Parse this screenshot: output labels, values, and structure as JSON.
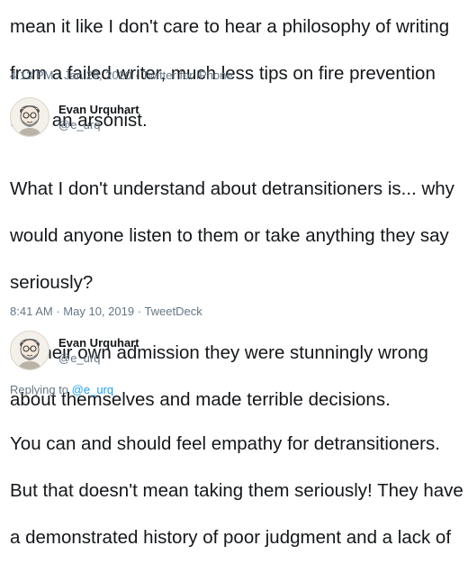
{
  "tweet1": {
    "lines": [
      "mean it like I don't care to hear a philosophy of writing",
      "from a failed writer, much less tips on fire prevention",
      "from an arsonist."
    ],
    "time": "4:13 PM",
    "date": "Jan 29, 2020",
    "client": "Twitter for iPhone"
  },
  "tweet2": {
    "author_name": "Evan Urquhart",
    "author_handle": "@e_urq",
    "para1": [
      "What I don't understand about detransitioners is... why",
      "would anyone listen to them or take anything they say",
      "seriously?"
    ],
    "para2": [
      "By their own admission they were stunningly wrong",
      "about themselves and made terrible decisions."
    ],
    "time": "8:41 AM",
    "date": "May 10, 2019",
    "client": "TweetDeck"
  },
  "tweet3": {
    "author_name": "Evan Urquhart",
    "author_handle": "@e_urq",
    "replying_label": "Replying to",
    "replying_to": "@e_urq",
    "lines": [
      "You can and should feel empathy for detransitioners.",
      "But that doesn't mean taking them seriously! They have",
      "a demonstrated history of poor judgment and a lack of"
    ]
  },
  "separator": "·",
  "icons": {
    "avatar": "cartoon-avatar-icon"
  }
}
